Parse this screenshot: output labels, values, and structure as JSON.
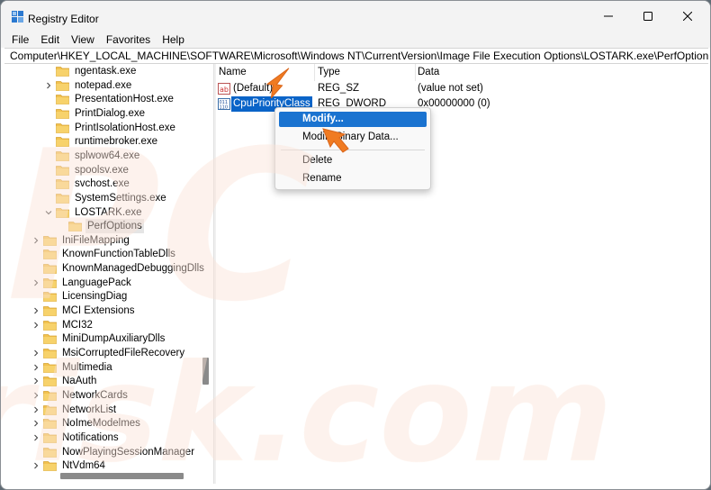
{
  "window": {
    "title": "Registry Editor",
    "controls": {
      "minimize": "minimize-icon",
      "maximize": "maximize-icon",
      "close": "close-icon"
    }
  },
  "menubar": {
    "items": [
      "File",
      "Edit",
      "View",
      "Favorites",
      "Help"
    ]
  },
  "address": "Computer\\HKEY_LOCAL_MACHINE\\SOFTWARE\\Microsoft\\Windows NT\\CurrentVersion\\Image File Execution Options\\LOSTARK.exe\\PerfOptions",
  "tree": {
    "items": [
      {
        "label": "ngentask.exe",
        "expandable": false
      },
      {
        "label": "notepad.exe",
        "expandable": true
      },
      {
        "label": "PresentationHost.exe",
        "expandable": false
      },
      {
        "label": "PrintDialog.exe",
        "expandable": false
      },
      {
        "label": "PrintIsolationHost.exe",
        "expandable": false
      },
      {
        "label": "runtimebroker.exe",
        "expandable": false
      },
      {
        "label": "splwow64.exe",
        "expandable": false
      },
      {
        "label": "spoolsv.exe",
        "expandable": false
      },
      {
        "label": "svchost.exe",
        "expandable": false
      },
      {
        "label": "SystemSettings.exe",
        "expandable": false
      },
      {
        "label": "LOSTARK.exe",
        "expandable": true,
        "expanded": true
      },
      {
        "label": "PerfOptions",
        "expandable": false,
        "selected": true
      },
      {
        "label": "IniFileMapping",
        "expandable": true
      },
      {
        "label": "KnownFunctionTableDlls",
        "expandable": false
      },
      {
        "label": "KnownManagedDebuggingDlls",
        "expandable": false
      },
      {
        "label": "LanguagePack",
        "expandable": true
      },
      {
        "label": "LicensingDiag",
        "expandable": false
      },
      {
        "label": "MCI Extensions",
        "expandable": true
      },
      {
        "label": "MCI32",
        "expandable": true
      },
      {
        "label": "MiniDumpAuxiliaryDlls",
        "expandable": false
      },
      {
        "label": "MsiCorruptedFileRecovery",
        "expandable": true
      },
      {
        "label": "Multimedia",
        "expandable": true
      },
      {
        "label": "NaAuth",
        "expandable": true
      },
      {
        "label": "NetworkCards",
        "expandable": true
      },
      {
        "label": "NetworkList",
        "expandable": true
      },
      {
        "label": "NoImeModelmes",
        "expandable": true
      },
      {
        "label": "Notifications",
        "expandable": true
      },
      {
        "label": "NowPlayingSessionManager",
        "expandable": false
      },
      {
        "label": "NtVdm64",
        "expandable": true
      }
    ]
  },
  "values": {
    "columns": {
      "name": "Name",
      "type": "Type",
      "data": "Data"
    },
    "rows": [
      {
        "name": "(Default)",
        "type": "REG_SZ",
        "data": "(value not set)",
        "icon": "string-value-icon"
      },
      {
        "name": "CpuPriorityClass",
        "type": "REG_DWORD",
        "data": "0x00000000 (0)",
        "icon": "binary-value-icon",
        "active": true
      }
    ]
  },
  "context_menu": {
    "items": [
      "Modify...",
      "Modify Binary Data...",
      "Delete",
      "Rename"
    ],
    "highlighted": "Modify..."
  },
  "colors": {
    "selection": "#0a64c8",
    "menu_highlight": "#1a73d0",
    "arrow": "#f07b22",
    "folder": "#f2c24f"
  }
}
